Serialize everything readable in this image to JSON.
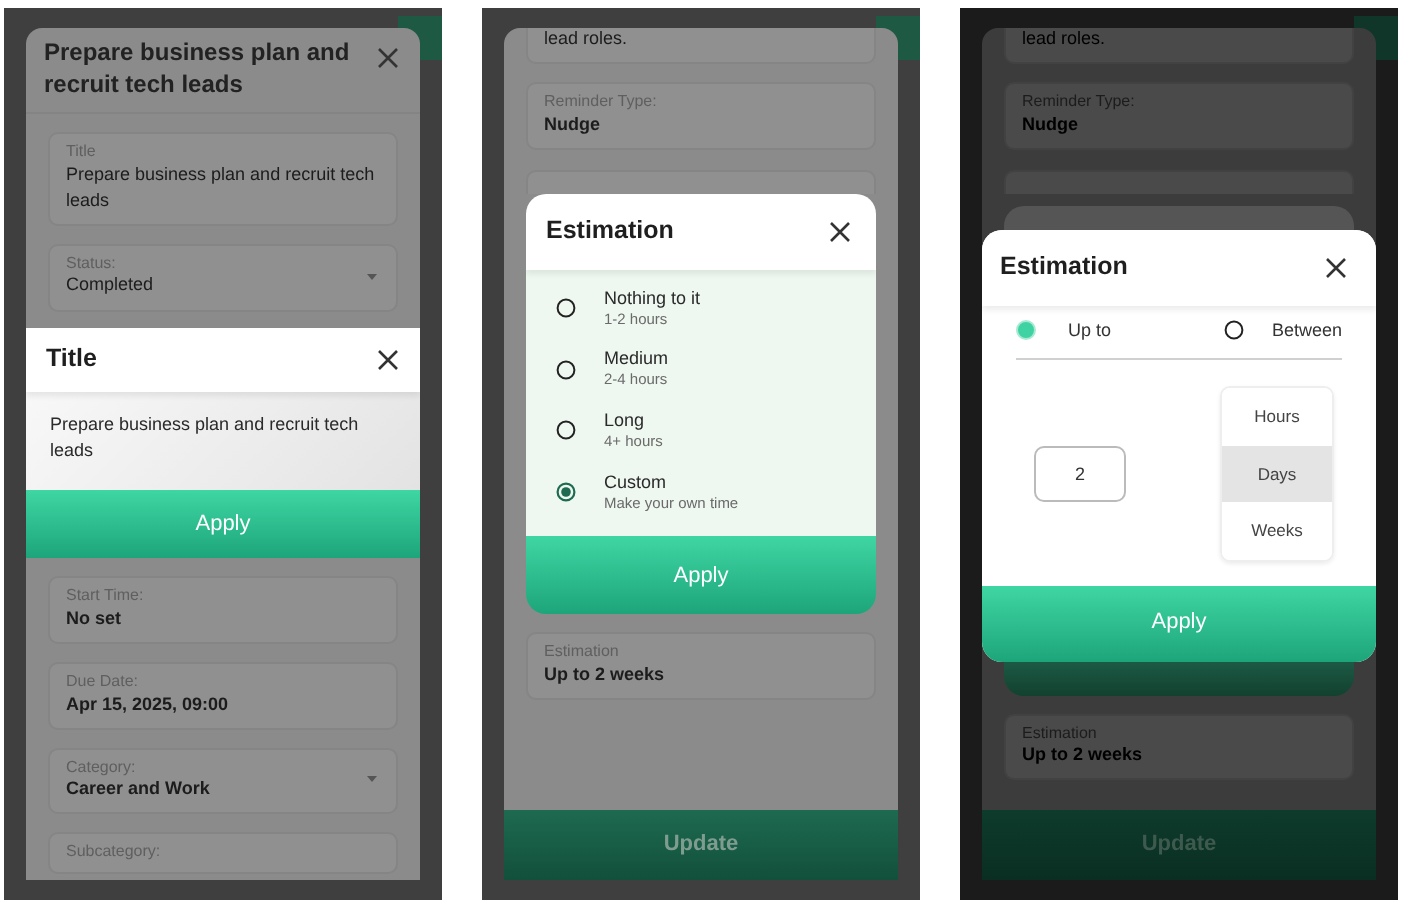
{
  "screens": [
    {
      "sheet": {
        "title": "Prepare business plan and recruit tech leads",
        "fields_before": [
          {
            "kind": "text",
            "label": "Title",
            "value": "Prepare business plan and recruit tech leads",
            "emphasis": false
          },
          {
            "kind": "select",
            "label": "Status:",
            "value": "Completed",
            "emphasis": false
          }
        ],
        "fields_after": [
          {
            "kind": "text",
            "label": "Start Time:",
            "value": "No set",
            "emphasis": true
          },
          {
            "kind": "text",
            "label": "Due Date:",
            "value": "Apr 15, 2025, 09:00",
            "emphasis": true
          },
          {
            "kind": "select",
            "label": "Category:",
            "value": "Career and Work",
            "emphasis": true
          },
          {
            "kind": "text",
            "label": "Subcategory:"
          }
        ]
      },
      "back_modal": false,
      "modal": {
        "kind": "text",
        "title": "Title",
        "body": "Prepare business plan and recruit tech leads",
        "apply": "Apply"
      }
    },
    {
      "sheet": {
        "fields_before": [
          {
            "kind": "text",
            "value": "lead roles.",
            "emphasis": false
          },
          {
            "kind": "text",
            "label": "Reminder Type:",
            "value": "Nudge",
            "emphasis": true
          },
          {
            "kind": "stub"
          }
        ],
        "fields_after": [
          {
            "kind": "text",
            "label": "Estimation",
            "value": "Up to 2 weeks",
            "emphasis": true
          }
        ],
        "footer_button": "Update"
      },
      "back_modal": false,
      "modal": {
        "kind": "options",
        "title": "Estimation",
        "options": [
          {
            "label": "Nothing to it",
            "detail": "1-2 hours",
            "selected": false
          },
          {
            "label": "Medium",
            "detail": "2-4 hours",
            "selected": false
          },
          {
            "label": "Long",
            "detail": "4+ hours",
            "selected": false
          },
          {
            "label": "Custom",
            "detail": "Make your own time",
            "selected": true
          }
        ],
        "apply": "Apply"
      }
    },
    {
      "sheet": {
        "fields_before": [
          {
            "kind": "text",
            "value": "lead roles.",
            "emphasis": false
          },
          {
            "kind": "text",
            "label": "Reminder Type:",
            "value": "Nudge",
            "emphasis": true
          },
          {
            "kind": "stub"
          }
        ],
        "fields_after": [
          {
            "kind": "text",
            "label": "Estimation",
            "value": "Up to 2 weeks",
            "emphasis": true
          }
        ],
        "footer_button": "Update"
      },
      "back_modal": true,
      "modal": {
        "kind": "custom",
        "title": "Estimation",
        "modes": [
          {
            "label": "Up to",
            "selected": true
          },
          {
            "label": "Between",
            "selected": false
          }
        ],
        "amount": "2",
        "units": [
          {
            "label": "Hours",
            "selected": false
          },
          {
            "label": "Days",
            "selected": true
          },
          {
            "label": "Weeks",
            "selected": false
          }
        ],
        "apply": "Apply"
      }
    }
  ]
}
